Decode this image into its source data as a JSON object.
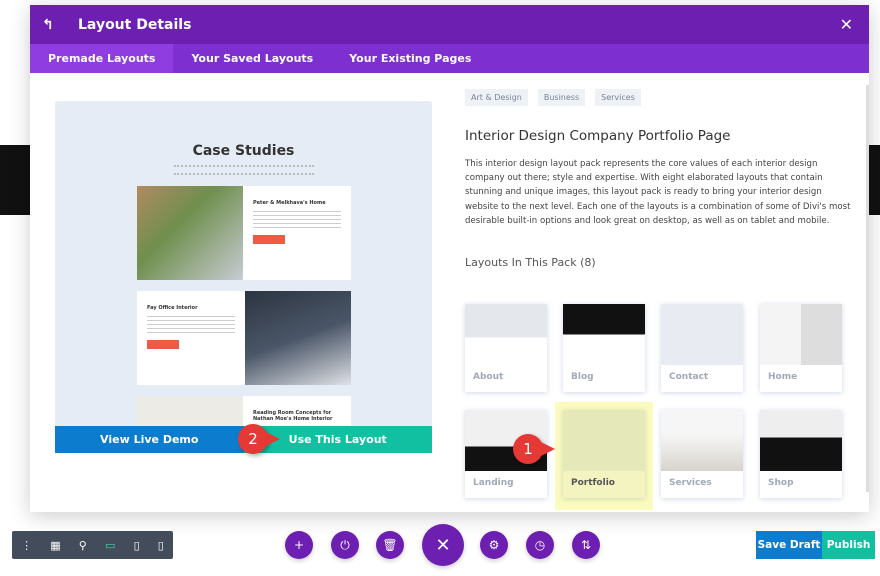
{
  "modal": {
    "title": "Layout Details",
    "tabs": [
      "Premade Layouts",
      "Your Saved Layouts",
      "Your Existing Pages"
    ]
  },
  "preview": {
    "heading": "Case Studies",
    "cards": [
      "Peter & Melkhava's Home",
      "Fay Office Interior",
      "Reading Room Concepts for Nathan Moe's Home Interior"
    ],
    "view_demo": "View Live Demo",
    "use_layout": "Use This Layout"
  },
  "annotations": [
    "1",
    "2"
  ],
  "details": {
    "tags": [
      "Art & Design",
      "Business",
      "Services"
    ],
    "title": "Interior Design Company Portfolio Page",
    "description": "This interior design layout pack represents the core values of each interior design company out there; style and expertise. With eight elaborated layouts that contain stunning and unique images, this layout pack is ready to bring your interior design website to the next level. Each one of the layouts is a combination of some of Divi's most desirable built-in options and look great on desktop, as well as on tablet and mobile.",
    "layouts_heading": "Layouts In This Pack (8)",
    "layouts": [
      "About",
      "Blog",
      "Contact",
      "Home",
      "Landing",
      "Portfolio",
      "Services",
      "Shop"
    ],
    "selected": "Portfolio"
  },
  "footer": {
    "save_draft": "Save Draft",
    "publish": "Publish"
  },
  "colors": {
    "purple": "#6c1fb0",
    "blue": "#0c7ccf",
    "teal": "#10c0a0",
    "highlight": "#fbfbbe"
  }
}
